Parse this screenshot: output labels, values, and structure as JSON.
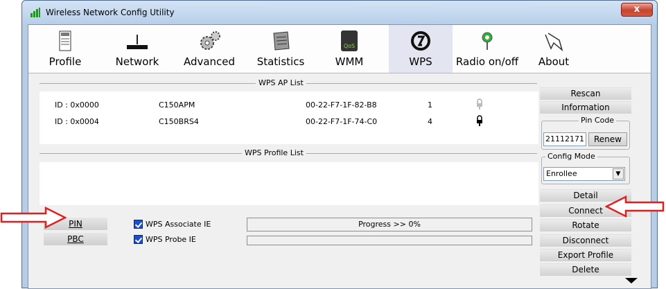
{
  "window": {
    "title": "Wireless Network Config Utility",
    "close_glyph": "x"
  },
  "toolbar": {
    "items": [
      {
        "label": "Profile",
        "icon": "profile-icon"
      },
      {
        "label": "Network",
        "icon": "network-icon"
      },
      {
        "label": "Advanced",
        "icon": "advanced-icon"
      },
      {
        "label": "Statistics",
        "icon": "statistics-icon"
      },
      {
        "label": "WMM",
        "icon": "wmm-icon"
      },
      {
        "label": "WPS",
        "icon": "wps-icon",
        "active": true
      },
      {
        "label": "Radio on/off",
        "icon": "radio-icon"
      },
      {
        "label": "About",
        "icon": "about-icon"
      }
    ]
  },
  "wps_ap_list": {
    "title": "WPS AP List",
    "rows": [
      {
        "id": "ID : 0x0000",
        "ssid": "C150APM",
        "bssid": "00-22-F7-1F-82-B8",
        "channel": "1",
        "lock": "unlocked"
      },
      {
        "id": "ID : 0x0004",
        "ssid": "C150BRS4",
        "bssid": "00-22-F7-1F-74-C0",
        "channel": "4",
        "lock": "locked"
      }
    ]
  },
  "wps_profile_list": {
    "title": "WPS Profile List"
  },
  "bottom": {
    "pin_button": "PIN",
    "pbc_button": "PBC",
    "associate_ie": "WPS Associate IE",
    "probe_ie": "WPS Probe IE",
    "progress_text": "Progress >> 0%",
    "progress_value": 0
  },
  "right_panel": {
    "rescan": "Rescan",
    "information": "Information",
    "pin_code_label": "Pin Code",
    "pin_code_value": "21112171",
    "renew": "Renew",
    "config_mode_label": "Config Mode",
    "config_mode_value": "Enrollee",
    "detail": "Detail",
    "connect": "Connect",
    "rotate": "Rotate",
    "disconnect": "Disconnect",
    "export_profile": "Export Profile",
    "delete": "Delete"
  },
  "colors": {
    "arrow": "#e02020",
    "accent_checkbox": "#1a4fc9",
    "active_tab": "#e3e6f0"
  }
}
